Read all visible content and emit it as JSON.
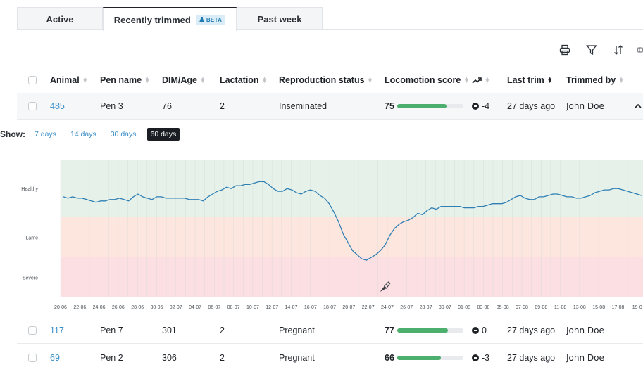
{
  "tabs": [
    {
      "label": "Active",
      "active": false
    },
    {
      "label": "Recently trimmed",
      "active": true,
      "badge": "BETA"
    },
    {
      "label": "Past week",
      "active": false
    }
  ],
  "toolbar": {
    "icons": [
      "print-icon",
      "filter-icon",
      "sort-icon",
      "columns-icon"
    ]
  },
  "table": {
    "columns": [
      "Animal",
      "Pen name",
      "DIM/Age",
      "Lactation",
      "Reproduction status",
      "Locomotion score",
      "",
      "Last trim",
      "Trimmed by"
    ],
    "rows": [
      {
        "animal": "485",
        "pen": "Pen 3",
        "dim": "76",
        "lactation": "2",
        "repro": "Inseminated",
        "score": "75",
        "score_pct": 75,
        "trend": "-4",
        "last_trim": "27 days ago",
        "trimmed_by": "John Doe"
      },
      {
        "animal": "117",
        "pen": "Pen 7",
        "dim": "301",
        "lactation": "2",
        "repro": "Pregnant",
        "score": "77",
        "score_pct": 77,
        "trend": "0",
        "last_trim": "27 days ago",
        "trimmed_by": "John Doe"
      },
      {
        "animal": "69",
        "pen": "Pen 2",
        "dim": "306",
        "lactation": "2",
        "repro": "Pregnant",
        "score": "66",
        "score_pct": 66,
        "trend": "-3",
        "last_trim": "27 days ago",
        "trimmed_by": "John Doe"
      }
    ]
  },
  "show": {
    "label": "Show:",
    "ranges": [
      {
        "label": "7 days",
        "selected": false
      },
      {
        "label": "14 days",
        "selected": false
      },
      {
        "label": "30 days",
        "selected": false
      },
      {
        "label": "60 days",
        "selected": true
      }
    ]
  },
  "chart_data": {
    "type": "line",
    "zones": [
      {
        "label": "Healthy",
        "color": "#e5f1e9"
      },
      {
        "label": "Lame",
        "color": "#fde6de"
      },
      {
        "label": "Severe",
        "color": "#fbdfe3"
      }
    ],
    "x_ticks": [
      "20-06",
      "22-06",
      "24-06",
      "26-06",
      "28-06",
      "30-06",
      "02-07",
      "04-07",
      "06-07",
      "08-07",
      "10-07",
      "12-07",
      "14-07",
      "16-07",
      "18-07",
      "20-07",
      "22-07",
      "24-07",
      "26-07",
      "28-07",
      "30-07",
      "01-08",
      "03-08",
      "05-08",
      "07-08",
      "09-08",
      "11-08",
      "13-08",
      "15-08",
      "17-08",
      "19-0"
    ],
    "trim_marker_index": 16,
    "y_range": [
      0,
      1
    ],
    "values": [
      0.73,
      0.72,
      0.73,
      0.72,
      0.72,
      0.71,
      0.7,
      0.69,
      0.7,
      0.7,
      0.71,
      0.71,
      0.72,
      0.71,
      0.7,
      0.73,
      0.75,
      0.73,
      0.72,
      0.71,
      0.73,
      0.73,
      0.72,
      0.72,
      0.72,
      0.72,
      0.72,
      0.71,
      0.71,
      0.71,
      0.7,
      0.73,
      0.75,
      0.77,
      0.78,
      0.8,
      0.79,
      0.81,
      0.81,
      0.82,
      0.82,
      0.83,
      0.84,
      0.84,
      0.82,
      0.79,
      0.77,
      0.77,
      0.79,
      0.78,
      0.76,
      0.75,
      0.77,
      0.78,
      0.77,
      0.74,
      0.72,
      0.68,
      0.62,
      0.55,
      0.46,
      0.4,
      0.34,
      0.31,
      0.28,
      0.27,
      0.29,
      0.31,
      0.34,
      0.38,
      0.45,
      0.5,
      0.53,
      0.55,
      0.56,
      0.58,
      0.61,
      0.6,
      0.63,
      0.65,
      0.64,
      0.66,
      0.66,
      0.66,
      0.66,
      0.66,
      0.65,
      0.65,
      0.65,
      0.66,
      0.66,
      0.67,
      0.68,
      0.68,
      0.68,
      0.69,
      0.71,
      0.73,
      0.74,
      0.72,
      0.71,
      0.71,
      0.73,
      0.73,
      0.74,
      0.75,
      0.75,
      0.74,
      0.73,
      0.73,
      0.72,
      0.72,
      0.73,
      0.74,
      0.76,
      0.77,
      0.78,
      0.78,
      0.79,
      0.79,
      0.78,
      0.77,
      0.76,
      0.75,
      0.74
    ]
  },
  "colors": {
    "accent": "#3b8fc8",
    "line": "#2f7fb5",
    "score_fill": "#4caf6e"
  }
}
